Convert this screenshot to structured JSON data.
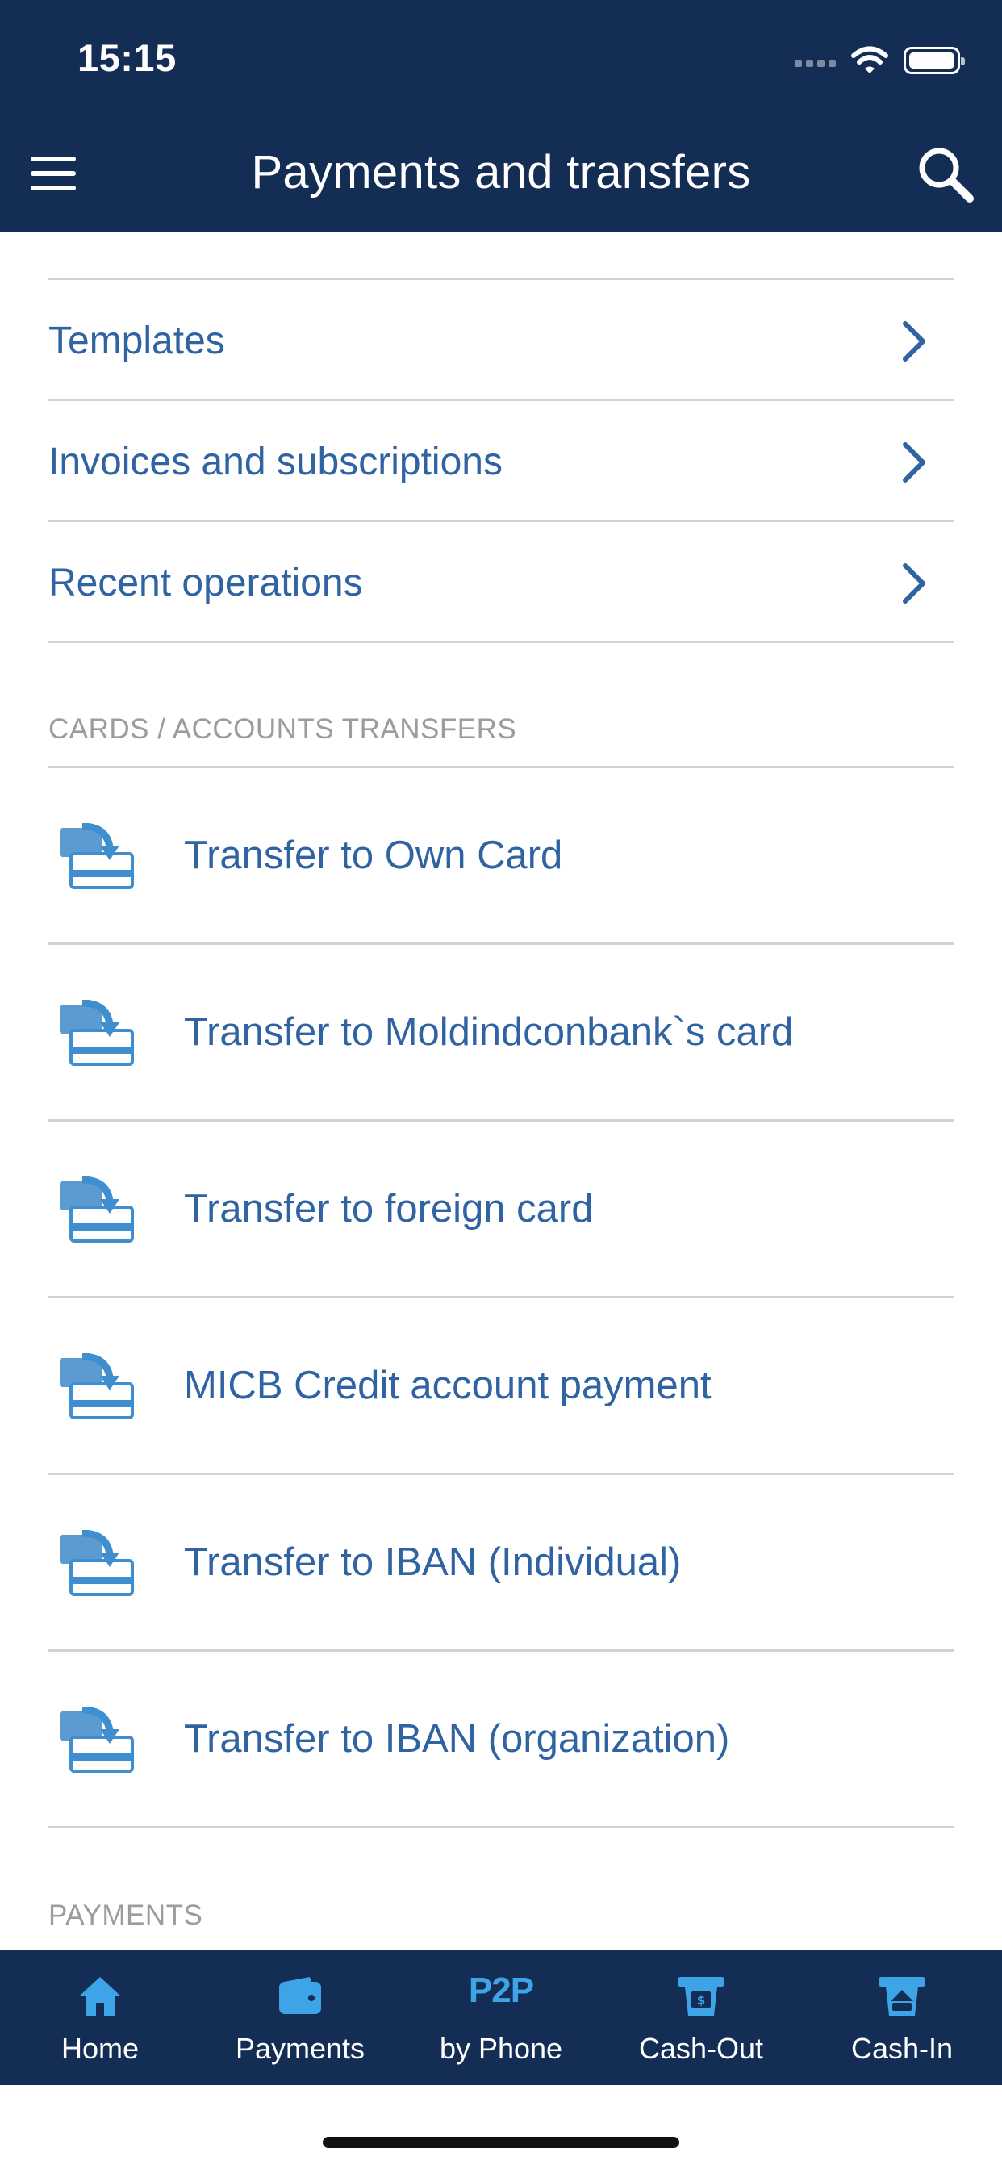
{
  "status_bar": {
    "time": "15:15"
  },
  "header": {
    "title": "Payments and transfers"
  },
  "quick_links": [
    {
      "label": "Templates"
    },
    {
      "label": "Invoices and subscriptions"
    },
    {
      "label": "Recent operations"
    }
  ],
  "sections": {
    "cards_accounts": "CARDS / ACCOUNTS TRANSFERS",
    "payments": "PAYMENTS"
  },
  "transfers": [
    {
      "label": "Transfer to Own Card"
    },
    {
      "label": "Transfer to Moldindconbank`s card"
    },
    {
      "label": "Transfer to foreign card"
    },
    {
      "label": "MICB Credit account payment"
    },
    {
      "label": "Transfer to IBAN (Individual)"
    },
    {
      "label": "Transfer to IBAN (organization)"
    }
  ],
  "tabbar": [
    {
      "label": "Home",
      "icon": "home-icon"
    },
    {
      "label": "Payments",
      "icon": "wallet-icon"
    },
    {
      "label": "by Phone",
      "badge": "P2P",
      "icon": "p2p-icon"
    },
    {
      "label": "Cash-Out",
      "icon": "cash-out-icon"
    },
    {
      "label": "Cash-In",
      "icon": "cash-in-icon"
    }
  ],
  "colors": {
    "header_bg": "#132d55",
    "link_blue": "#2f63a2",
    "icon_blue": "#3ea4e8",
    "divider": "#d2d2d2",
    "section_gray": "#9c9c9c"
  }
}
